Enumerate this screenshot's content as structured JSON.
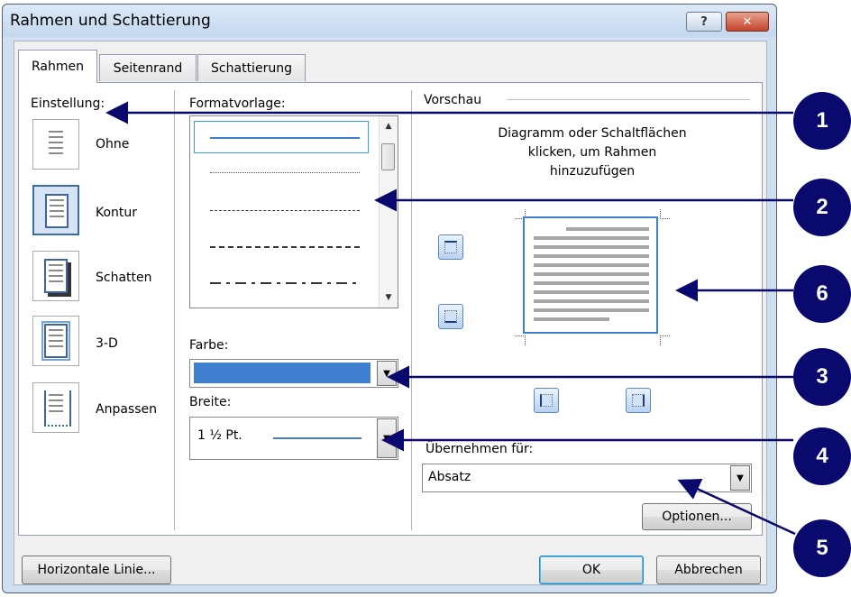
{
  "window": {
    "title": "Rahmen und Schattierung",
    "help_glyph": "?",
    "close_glyph": "✕"
  },
  "tabs": [
    {
      "label": "Rahmen"
    },
    {
      "label": "Seitenrand"
    },
    {
      "label": "Schattierung"
    }
  ],
  "einstellung": {
    "heading": "Einstellung:",
    "options": [
      {
        "label": "Ohne"
      },
      {
        "label": "Kontur"
      },
      {
        "label": "Schatten"
      },
      {
        "label": "3-D"
      },
      {
        "label": "Anpassen"
      }
    ]
  },
  "formatvorlage": {
    "heading": "Formatvorlage:"
  },
  "farbe": {
    "label": "Farbe:",
    "color": "#3f7fd0"
  },
  "breite": {
    "label": "Breite:",
    "value": "1 ½ Pt."
  },
  "vorschau": {
    "heading": "Vorschau",
    "description_lines": [
      "Diagramm oder Schaltflächen",
      "klicken, um Rahmen",
      "hinzuzufügen"
    ]
  },
  "uebernehmen": {
    "label": "Übernehmen für:",
    "value": "Absatz"
  },
  "buttons": {
    "optionen": "Optionen...",
    "horizontale_linie": "Horizontale Linie...",
    "ok": "OK",
    "abbrechen": "Abbrechen"
  },
  "callouts": [
    "1",
    "2",
    "3",
    "4",
    "5",
    "6"
  ],
  "accent_color": "#0a0a6e"
}
